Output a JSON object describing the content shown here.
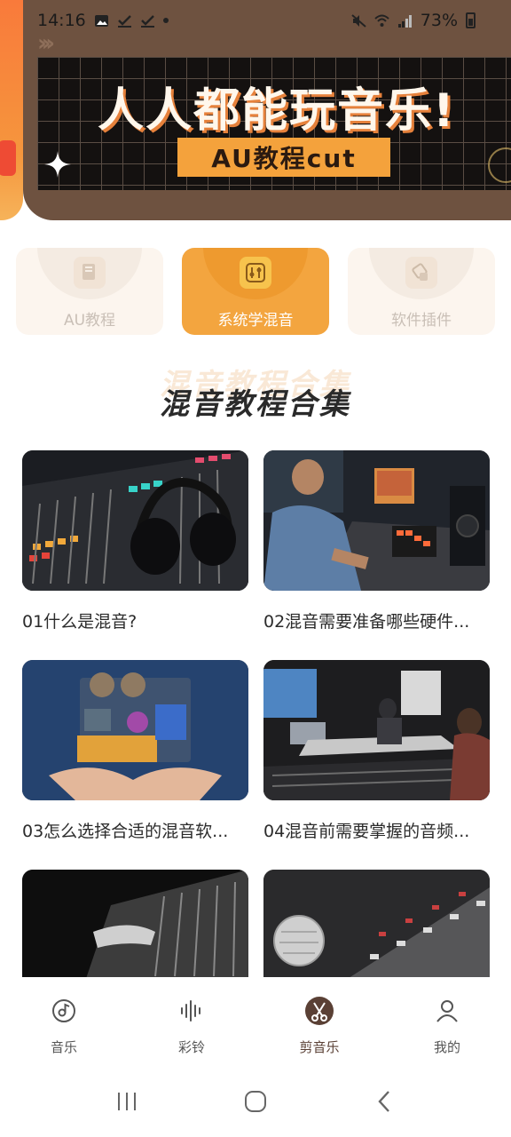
{
  "status_bar": {
    "time": "14:16",
    "battery": "73%"
  },
  "banner": {
    "title": "人人都能玩音乐!",
    "tag": "AU教程cut",
    "chevrons": "›››"
  },
  "categories": [
    {
      "label": "AU教程",
      "icon": "document-icon",
      "active": false
    },
    {
      "label": "系统学混音",
      "icon": "mixer-icon",
      "active": true
    },
    {
      "label": "软件插件",
      "icon": "plugin-icon",
      "active": false
    }
  ],
  "section": {
    "title": "混音教程合集"
  },
  "videos": [
    {
      "title": "01什么是混音?"
    },
    {
      "title": "02混音需要准备哪些硬件..."
    },
    {
      "title": "03怎么选择合适的混音软..."
    },
    {
      "title": "04混音前需要掌握的音频..."
    },
    {
      "title": ""
    },
    {
      "title": ""
    }
  ],
  "bottom_nav": [
    {
      "label": "音乐",
      "icon": "music-disc-icon",
      "active": false
    },
    {
      "label": "彩铃",
      "icon": "sound-wave-icon",
      "active": false
    },
    {
      "label": "剪音乐",
      "icon": "scissors-music-icon",
      "active": true
    },
    {
      "label": "我的",
      "icon": "person-icon",
      "active": false
    }
  ],
  "colors": {
    "accent": "#f3a53f",
    "banner_bg": "#6e5240",
    "active_nav": "#5a4035"
  }
}
